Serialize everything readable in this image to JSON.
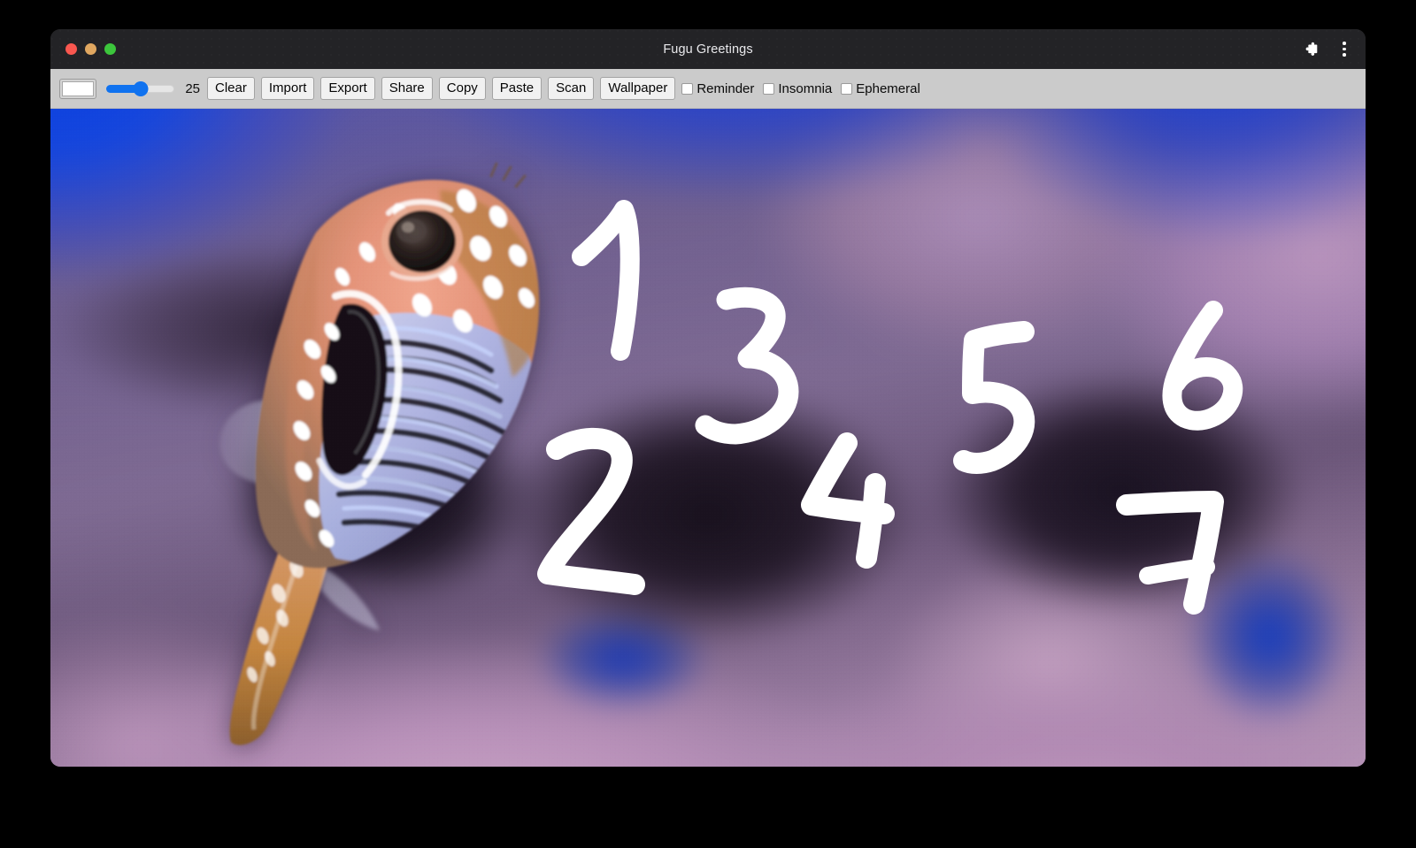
{
  "window": {
    "title": "Fugu Greetings",
    "traffic_lights": [
      "close",
      "minimize",
      "maximize"
    ],
    "actions": [
      {
        "name": "extensions-icon",
        "label": "Extensions"
      },
      {
        "name": "menu-kebab-icon",
        "label": "More"
      }
    ]
  },
  "toolbar": {
    "color_picker": {
      "value": "#ffffff",
      "label": "Pen color"
    },
    "slider": {
      "value": 25,
      "min": 0,
      "max": 50,
      "percent": 50,
      "accent": "#1072ef"
    },
    "slider_value_text": "25",
    "buttons": [
      {
        "name": "clear-button",
        "label": "Clear"
      },
      {
        "name": "import-button",
        "label": "Import"
      },
      {
        "name": "export-button",
        "label": "Export"
      },
      {
        "name": "share-button",
        "label": "Share"
      },
      {
        "name": "copy-button",
        "label": "Copy"
      },
      {
        "name": "paste-button",
        "label": "Paste"
      },
      {
        "name": "scan-button",
        "label": "Scan"
      },
      {
        "name": "wallpaper-button",
        "label": "Wallpaper"
      }
    ],
    "checkboxes": [
      {
        "name": "reminder-checkbox",
        "label": "Reminder",
        "checked": false
      },
      {
        "name": "insomnia-checkbox",
        "label": "Insomnia",
        "checked": false
      },
      {
        "name": "ephemeral-checkbox",
        "label": "Ephemeral",
        "checked": false
      }
    ]
  },
  "canvas": {
    "description": "Blurred underwater photo of a spotted pufferfish (fugu) against purple coral with blue water",
    "subject": "pufferfish",
    "ink_color": "#ffffff",
    "stroke_width": 25,
    "annotations": [
      {
        "name": "handwritten-digit-1",
        "text": "1"
      },
      {
        "name": "handwritten-digit-2",
        "text": "2"
      },
      {
        "name": "handwritten-digit-3",
        "text": "3"
      },
      {
        "name": "handwritten-digit-4",
        "text": "4"
      },
      {
        "name": "handwritten-digit-5",
        "text": "5"
      },
      {
        "name": "handwritten-digit-6",
        "text": "6"
      },
      {
        "name": "handwritten-digit-7",
        "text": "7"
      }
    ]
  }
}
